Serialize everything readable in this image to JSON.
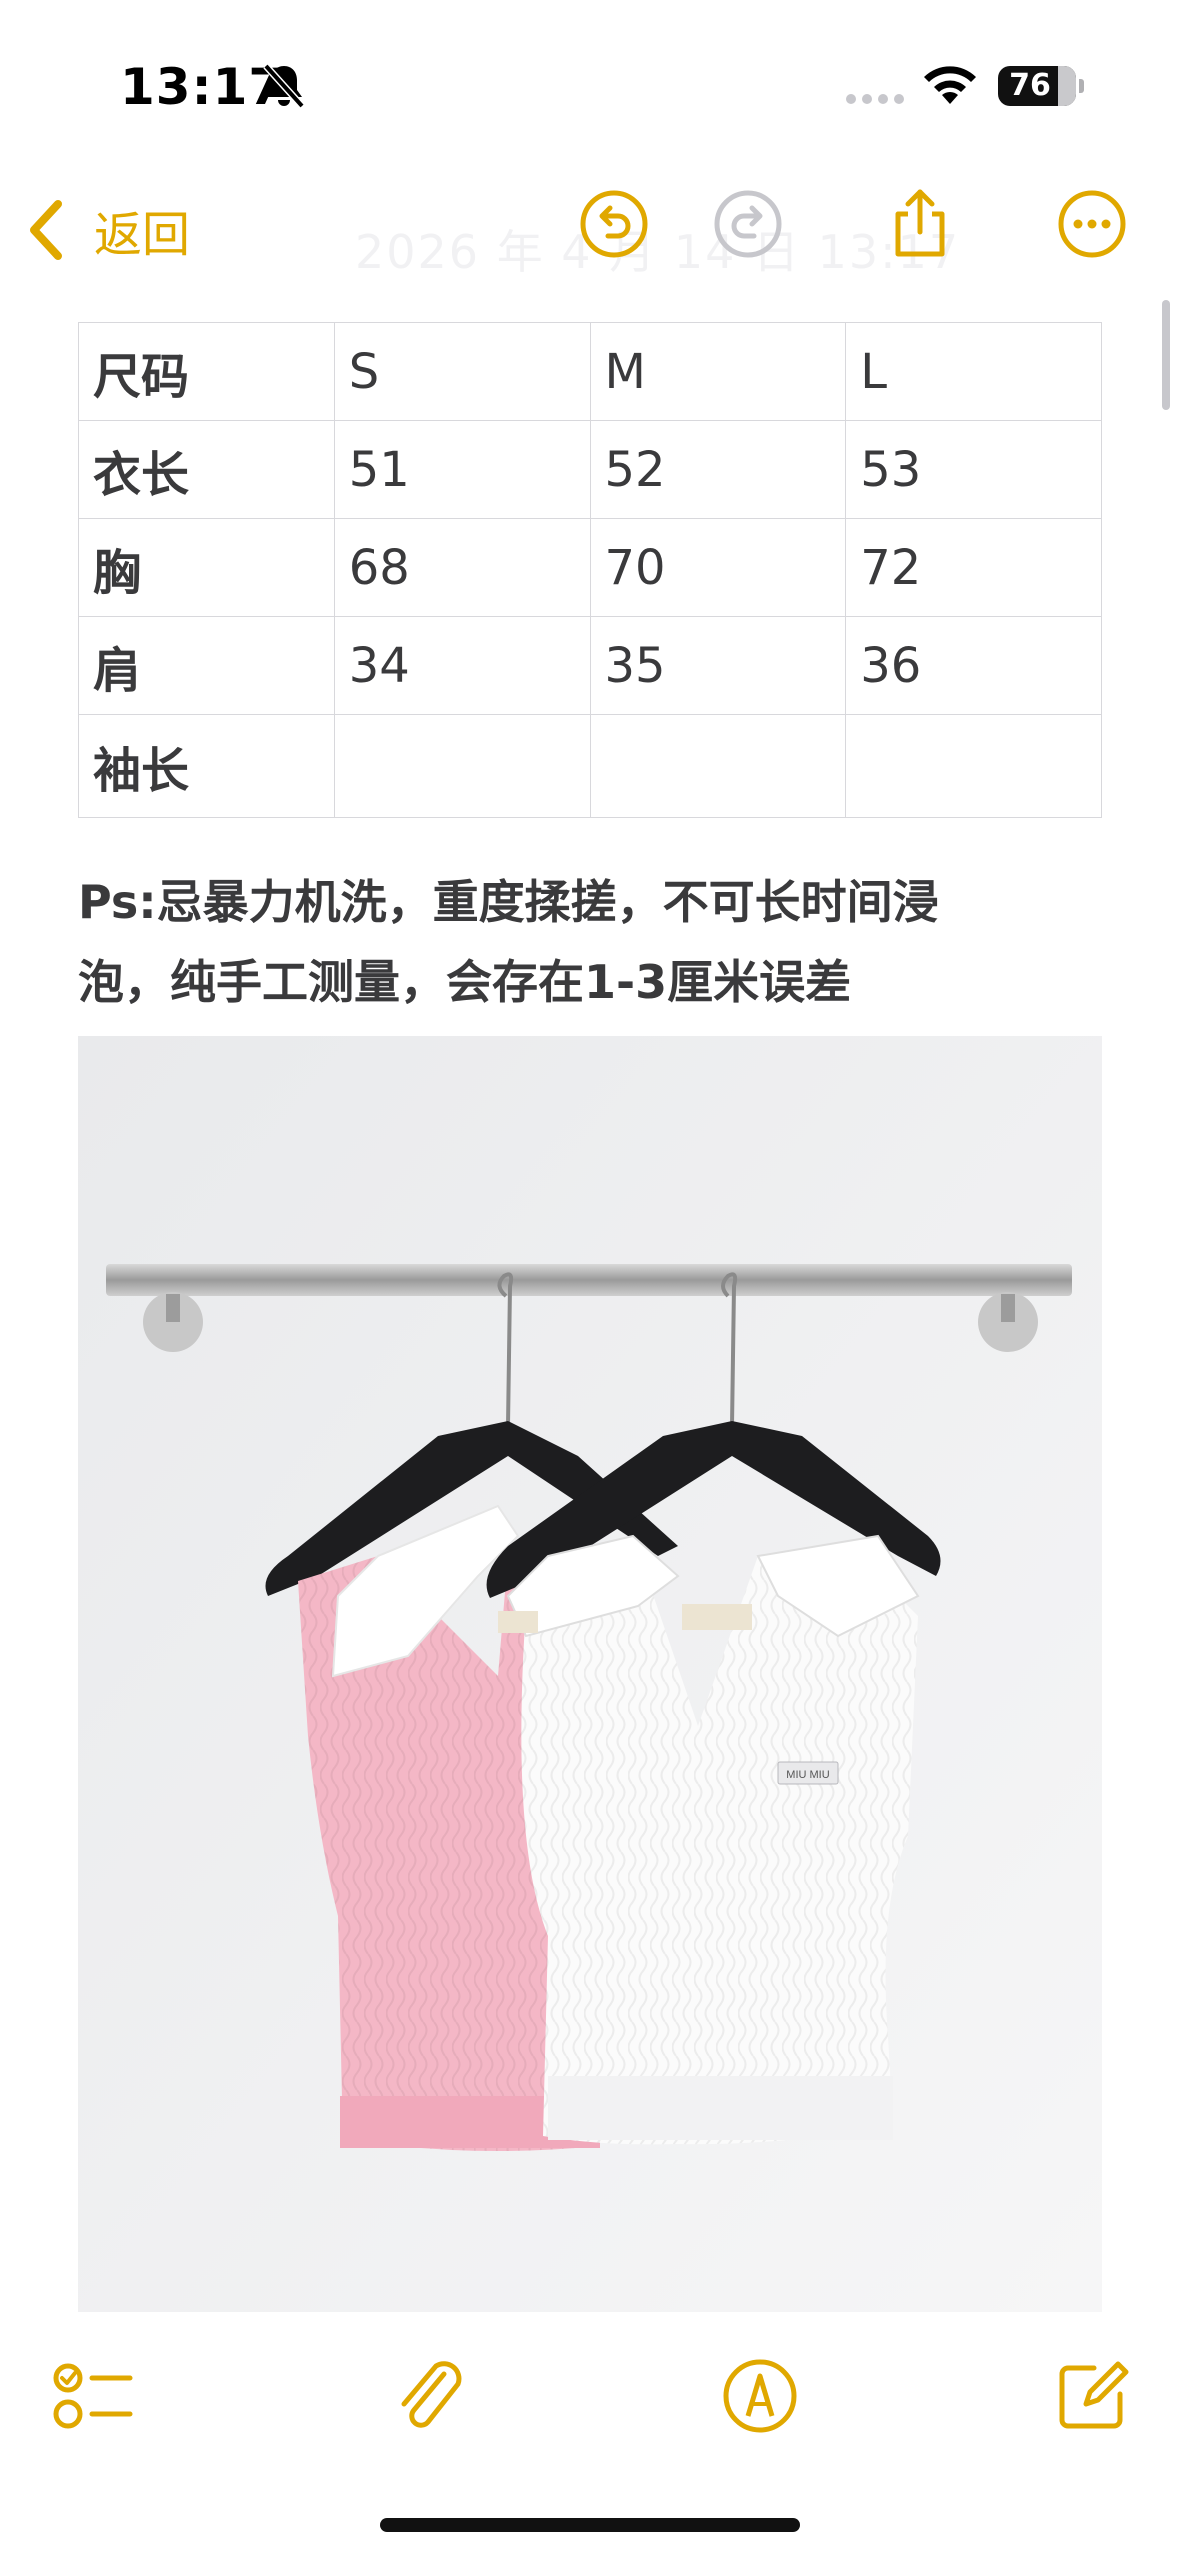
{
  "status_bar": {
    "time": "13:17",
    "silent_icon": "bell-slash-icon",
    "signal_icon": "cellular-dots-icon",
    "wifi_icon": "wifi-icon",
    "battery_percent": "76"
  },
  "toolbar": {
    "back_label": "返回",
    "ghost_date": "2026 年 4 月 14 日 13:17",
    "undo_icon": "undo-icon",
    "redo_icon": "redo-icon",
    "share_icon": "share-icon",
    "more_icon": "more-icon"
  },
  "table": {
    "rows": [
      {
        "label": "尺码",
        "cells": [
          "S",
          "M",
          "L"
        ]
      },
      {
        "label": "衣长",
        "cells": [
          "51",
          "52",
          "53"
        ]
      },
      {
        "label": "胸",
        "cells": [
          "68",
          "70",
          "72"
        ]
      },
      {
        "label": "肩",
        "cells": [
          "34",
          "35",
          "36"
        ]
      },
      {
        "label": "袖长",
        "cells": [
          "",
          "",
          ""
        ]
      }
    ]
  },
  "note": {
    "line1": "Ps:忌暴力机洗，重度揉搓，不可长时间浸",
    "line2": "泡，纯手工测量，会存在1-3厘米误差"
  },
  "photo": {
    "label_text": "MIU MIU"
  },
  "bottom_toolbar": {
    "checklist_icon": "checklist-icon",
    "attachment_icon": "paperclip-icon",
    "markup_icon": "markup-pen-icon",
    "compose_icon": "compose-icon"
  },
  "colors": {
    "accent": "#e0a800",
    "text": "#3a3a3c",
    "border": "#d8d8dc"
  }
}
